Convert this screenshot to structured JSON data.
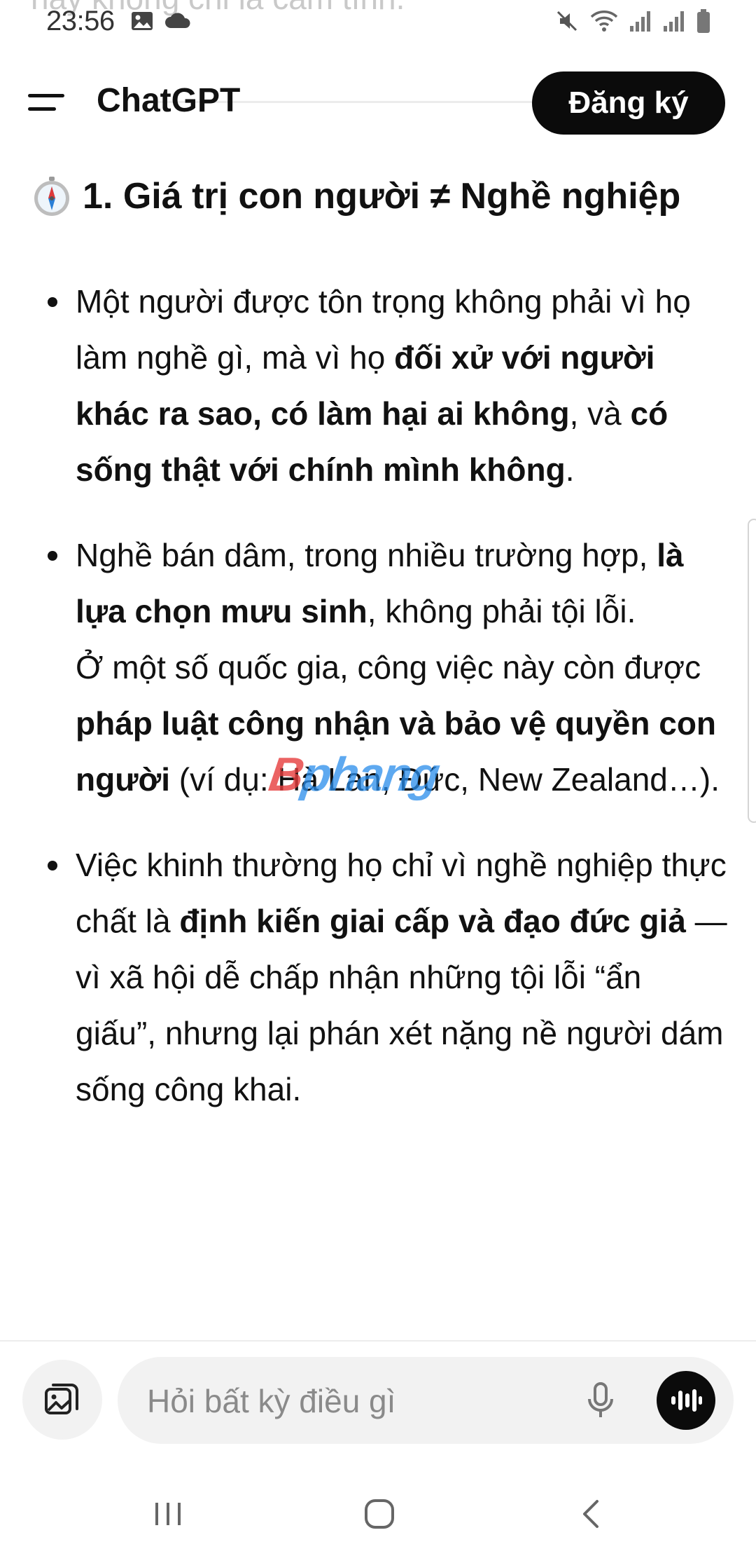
{
  "ghost_text": "này không chỉ là cảm tính.",
  "status_bar": {
    "time": "23:56",
    "icons": [
      "image-icon",
      "cloud-icon",
      "mute-icon",
      "wifi-icon",
      "signal-icon",
      "signal-icon",
      "battery-icon"
    ]
  },
  "header": {
    "title": "ChatGPT",
    "signup_label": "Đăng ký"
  },
  "section": {
    "heading": "1. Giá trị con người ≠ Nghề nghiệp",
    "bullets": [
      {
        "p1": "Một người được tôn trọng không phải vì họ làm nghề gì, mà vì họ ",
        "b1": "đối xử với người khác ra sao, có làm hại ai không",
        "p2": ", và ",
        "b2": "có sống thật với chính mình không",
        "p3": "."
      },
      {
        "p1": "Nghề bán dâm, trong nhiều trường hợp, ",
        "b1": "là lựa chọn mưu sinh",
        "p2": ", không phải tội lỗi.",
        "p3": "Ở một số quốc gia, công việc này còn được ",
        "b2": "pháp luật công nhận và bảo vệ quyền con người",
        "p4": " (ví dụ: Hà Lan, Đức, New Zealand…)."
      },
      {
        "p1": "Việc khinh thường họ chỉ vì nghề nghiệp thực chất là ",
        "b1": "định kiến giai cấp và đạo đức giả",
        "p2": " — vì xã hội dễ chấp nhận những tội lỗi “ẩn giấu”, nhưng lại phán xét nặng nề người dám sống công khai."
      }
    ]
  },
  "watermark": {
    "part1": "B",
    "part2": "phang"
  },
  "composer": {
    "placeholder": "Hỏi bất kỳ điều gì"
  },
  "colors": {
    "signup_bg": "#0b0b0b",
    "pill_bg": "#f2f2f2",
    "placeholder": "#8a8a8a"
  }
}
